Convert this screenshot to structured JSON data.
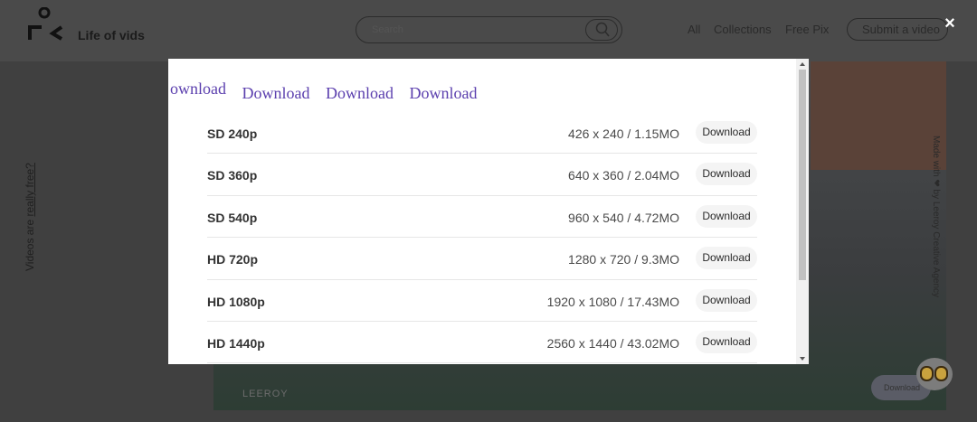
{
  "header": {
    "brand": "Life of vids",
    "search_placeholder": "Search",
    "nav": [
      "All",
      "Collections",
      "Free Pix"
    ],
    "submit_label": "Submit a video"
  },
  "sidebar": {
    "text_prefix": "Videos are ",
    "text_link": "really free?"
  },
  "hero": {
    "caption": "LEEROY",
    "download_label": "Download",
    "vertical_text": "Made with ❤ by Leeroy Creative Agency"
  },
  "modal": {
    "tabs": [
      "Download",
      "Download",
      "Download",
      "Download"
    ],
    "rows": [
      {
        "quality": "SD 240p",
        "size": "426 x 240 / 1.15MO",
        "button": "Download"
      },
      {
        "quality": "SD 360p",
        "size": "640 x 360 / 2.04MO",
        "button": "Download"
      },
      {
        "quality": "SD 540p",
        "size": "960 x 540 / 4.72MO",
        "button": "Download"
      },
      {
        "quality": "HD 720p",
        "size": "1280 x 720 / 9.3MO",
        "button": "Download"
      },
      {
        "quality": "HD 1080p",
        "size": "1920 x 1080 / 17.43MO",
        "button": "Download"
      },
      {
        "quality": "HD 1440p",
        "size": "2560 x 1440 / 43.02MO",
        "button": "Download"
      }
    ],
    "accent_color": "#5b3fae"
  },
  "close_label": "×"
}
